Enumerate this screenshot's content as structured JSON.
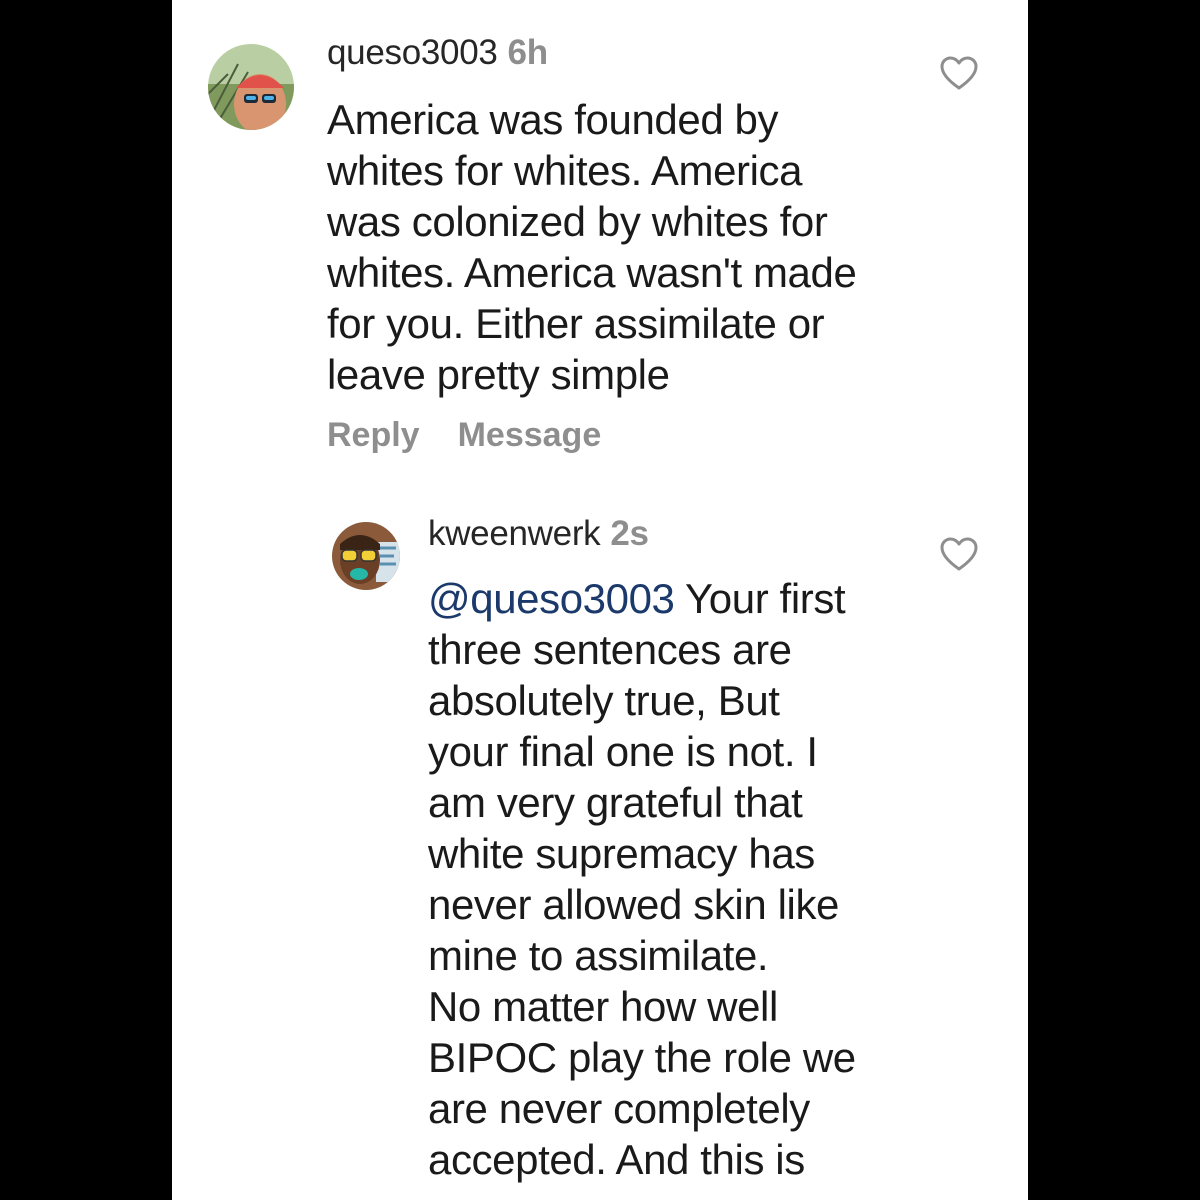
{
  "comments": [
    {
      "username": "queso3003",
      "time": "6h",
      "avatar_icon": "profile-avatar-red-cap",
      "lines": [
        "America was founded by",
        "whites for whites. America",
        "was colonized by whites for",
        "whites. America wasn't made",
        "for you. Either assimilate or",
        "leave pretty simple"
      ],
      "actions": {
        "reply_label": "Reply",
        "message_label": "Message"
      },
      "like_icon": "heart-outline-icon"
    },
    {
      "username": "kweenwerk",
      "time": "2s",
      "avatar_icon": "profile-avatar-yellow-glasses",
      "mention": "@queso3003",
      "first_line_rest": " Your first",
      "lines": [
        "three sentences are",
        "absolutely true, But",
        "your final one is not. I",
        "am very grateful that",
        "white supremacy has",
        "never allowed skin like",
        "mine to assimilate.",
        "No matter how well",
        "BIPOC play the role we",
        "are never completely",
        "accepted. And this is"
      ],
      "like_icon": "heart-outline-icon"
    }
  ],
  "colors": {
    "background": "#ffffff",
    "frame": "#000000",
    "text": "#1a1a1a",
    "secondary": "#8e8e8e",
    "mention": "#1b3a6b"
  }
}
